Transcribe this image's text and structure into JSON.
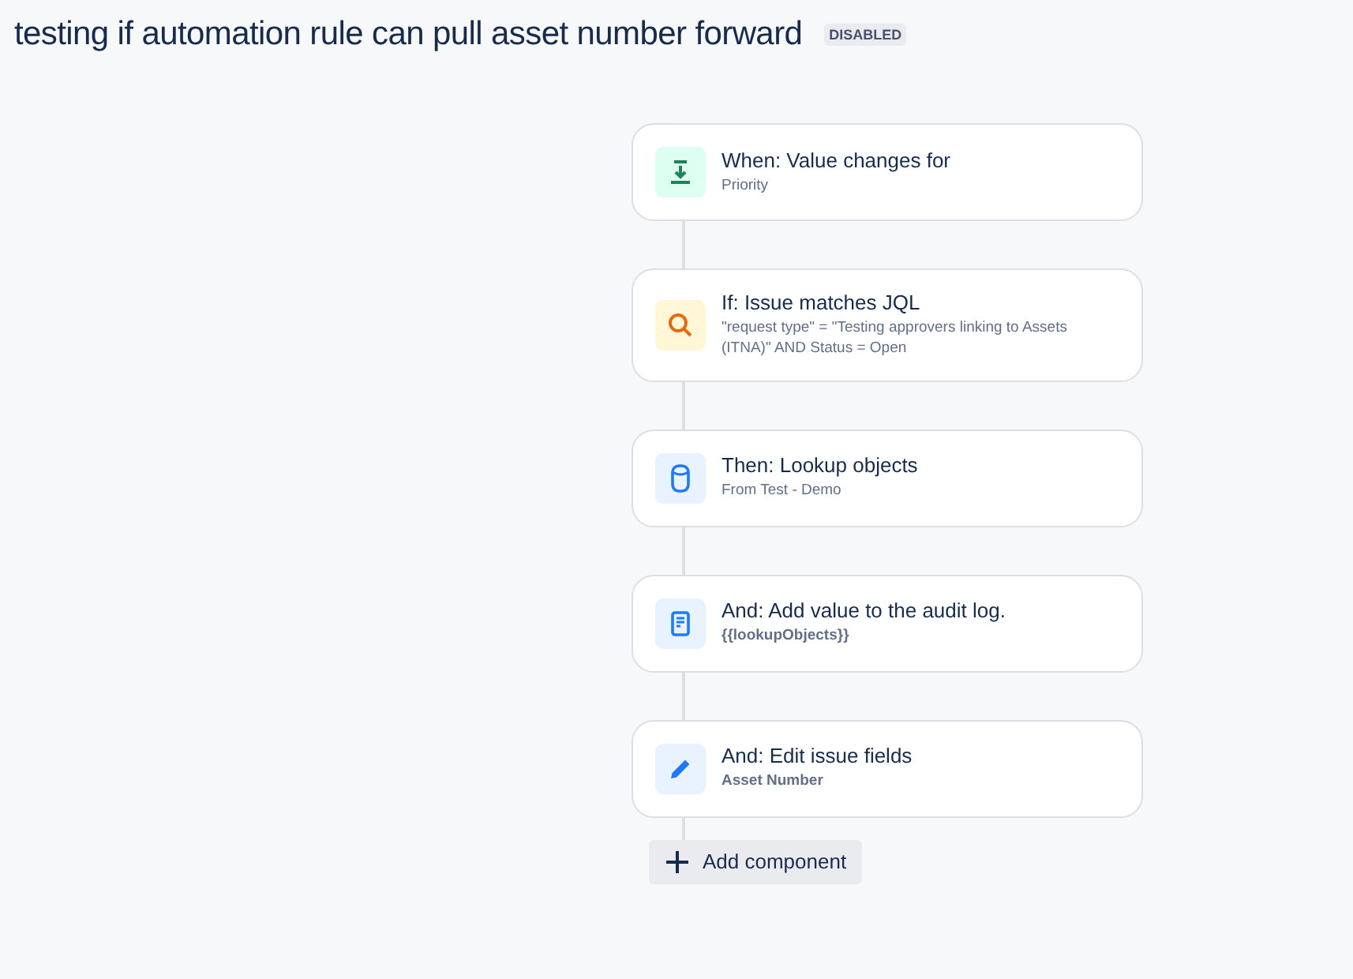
{
  "title": "testing if automation rule can pull asset number forward",
  "status_badge": "DISABLED",
  "steps": [
    {
      "kind": "trigger",
      "label": "When: Value changes for",
      "detail": "Priority",
      "detail_bold": false
    },
    {
      "kind": "condition",
      "label": "If: Issue matches JQL",
      "detail": "\"request type\" = \"Testing approvers linking to Assets (ITNA)\" AND Status = Open",
      "detail_bold": false
    },
    {
      "kind": "lookup",
      "label": "Then: Lookup objects",
      "detail": "From Test - Demo",
      "detail_bold": false
    },
    {
      "kind": "log",
      "label": "And: Add value to the audit log.",
      "detail": "{{lookupObjects}}",
      "detail_bold": true
    },
    {
      "kind": "edit",
      "label": "And: Edit issue fields",
      "detail": "Asset Number",
      "detail_bold": true
    }
  ],
  "add_button": "Add component"
}
